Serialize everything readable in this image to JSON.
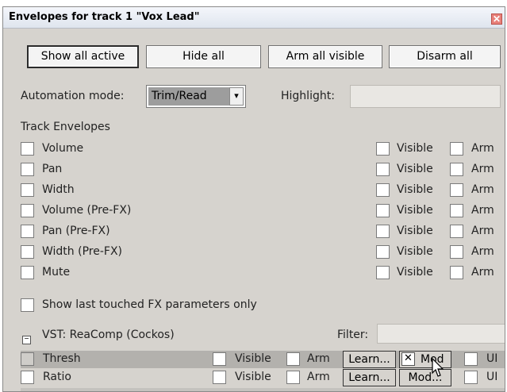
{
  "window": {
    "title": "Envelopes for track 1 \"Vox Lead\"",
    "close_glyph": "✕"
  },
  "buttons": {
    "show_all_active": "Show all active",
    "hide_all": "Hide all",
    "arm_all_visible": "Arm all visible",
    "disarm_all": "Disarm all"
  },
  "automation": {
    "label": "Automation mode:",
    "value": "Trim/Read",
    "arrow": "▾",
    "highlight_label": "Highlight:"
  },
  "track_envelopes": {
    "heading": "Track Envelopes",
    "visible_label": "Visible",
    "arm_label": "Arm",
    "items": [
      {
        "name": "Volume"
      },
      {
        "name": "Pan"
      },
      {
        "name": "Width"
      },
      {
        "name": "Volume (Pre-FX)"
      },
      {
        "name": "Pan (Pre-FX)"
      },
      {
        "name": "Width (Pre-FX)"
      },
      {
        "name": "Mute"
      }
    ]
  },
  "show_last_touched": "Show last touched FX parameters only",
  "fx": {
    "expander_glyph": "−",
    "name": "VST: ReaComp (Cockos)",
    "filter_label": "Filter:",
    "visible_label": "Visible",
    "arm_label": "Arm",
    "learn_label": "Learn...",
    "ui_label": "UI",
    "params": [
      {
        "name": "Thresh",
        "mod_label": "Mod",
        "mod_checked": "✕"
      },
      {
        "name": "Ratio",
        "mod_label": "Mod..."
      }
    ]
  },
  "colors": {
    "dialog_bg": "#d6d3ce",
    "combo_selection": "#9d9d9d",
    "close_button": "#e8807a"
  }
}
